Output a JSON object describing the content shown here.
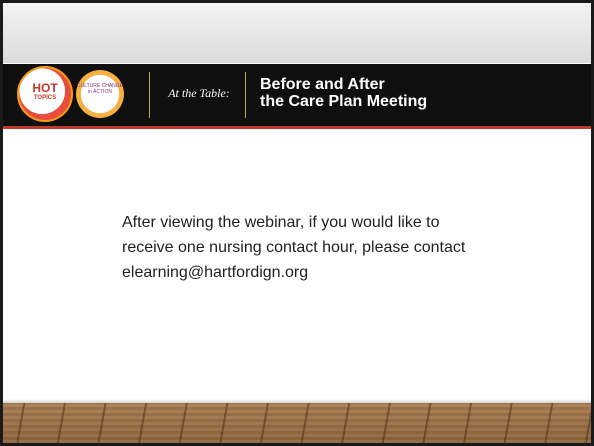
{
  "header": {
    "logo_hot": "HOT",
    "logo_hot_sub": "TOPICS",
    "logo_culture": "CULTURE CHANGE in ACTION",
    "series_label": "At the Table:",
    "title_line1": "Before and After",
    "title_line2": "the Care Plan Meeting"
  },
  "body": {
    "line1": "After viewing the webinar, if you would like to",
    "line2": "receive one nursing contact hour, please contact",
    "line3": "elearning@hartfordign.org"
  }
}
